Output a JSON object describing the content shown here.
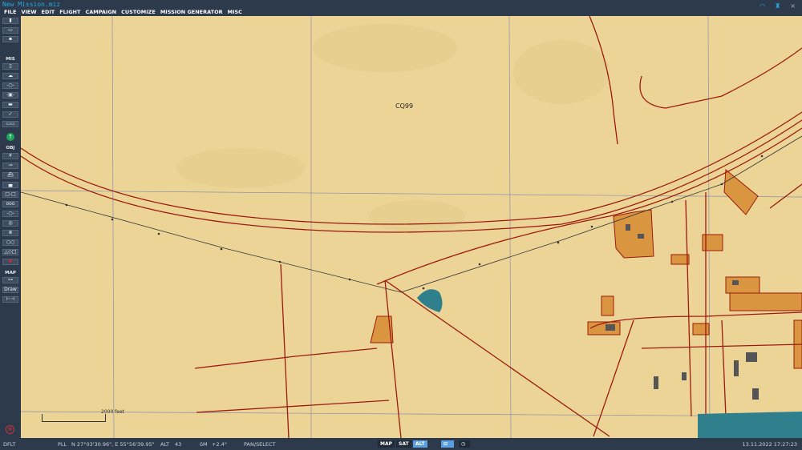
{
  "window": {
    "title": "New Mission.miz",
    "icons": [
      "wifi-icon",
      "signal-tower-icon",
      "close-icon"
    ],
    "close": "×"
  },
  "menu": [
    "FILE",
    "VIEW",
    "EDIT",
    "FLIGHT",
    "CAMPAIGN",
    "CUSTOMIZE",
    "MISSION GENERATOR",
    "MISC"
  ],
  "sidebar": {
    "file_icons": [
      "new-file-icon",
      "open-folder-icon",
      "save-icon"
    ],
    "mis_label": "MIS",
    "mis_icons": [
      "clipboard-icon",
      "weather-icon",
      "route-icon",
      "trigger-icon",
      "briefing-icon",
      "check-icon",
      "mission-goals-icon"
    ],
    "obj_label": "OBJ",
    "obj_icons": [
      "aircraft-icon",
      "helicopter-icon",
      "ship-icon",
      "vehicle-icon",
      "static-object-icon",
      "group-icon",
      "waypoint-icon",
      "target-zone-icon",
      "navpoint-icon",
      "bullseye-icon",
      "shapes-icon",
      "delete-icon"
    ],
    "map_label": "MAP",
    "map_icons": [
      "ruler-icon"
    ],
    "draw_label": "Draw",
    "measure_icon": "measure-icon"
  },
  "map": {
    "grid_label": "CQ99",
    "scale_label": "2000 feet",
    "colors": {
      "land": "#ecd496",
      "road": "#9c1a0e",
      "water": "#2f7f8c",
      "town": "#d9953f"
    }
  },
  "bottombar": {
    "profile": "DFLT",
    "coord_mode": "PLL",
    "coords": "N 27°03'30.96\", E 55°56'39.95\"",
    "alt_label": "ALT",
    "alt_value": "43",
    "magvar_label": "δM",
    "magvar_value": "+2.4°",
    "mode": "PAN/SELECT",
    "map_btn": "MAP",
    "sat_btn": "SAT",
    "alt_btn": "ALT",
    "datetime": "13.11.2022 17:27:23"
  }
}
